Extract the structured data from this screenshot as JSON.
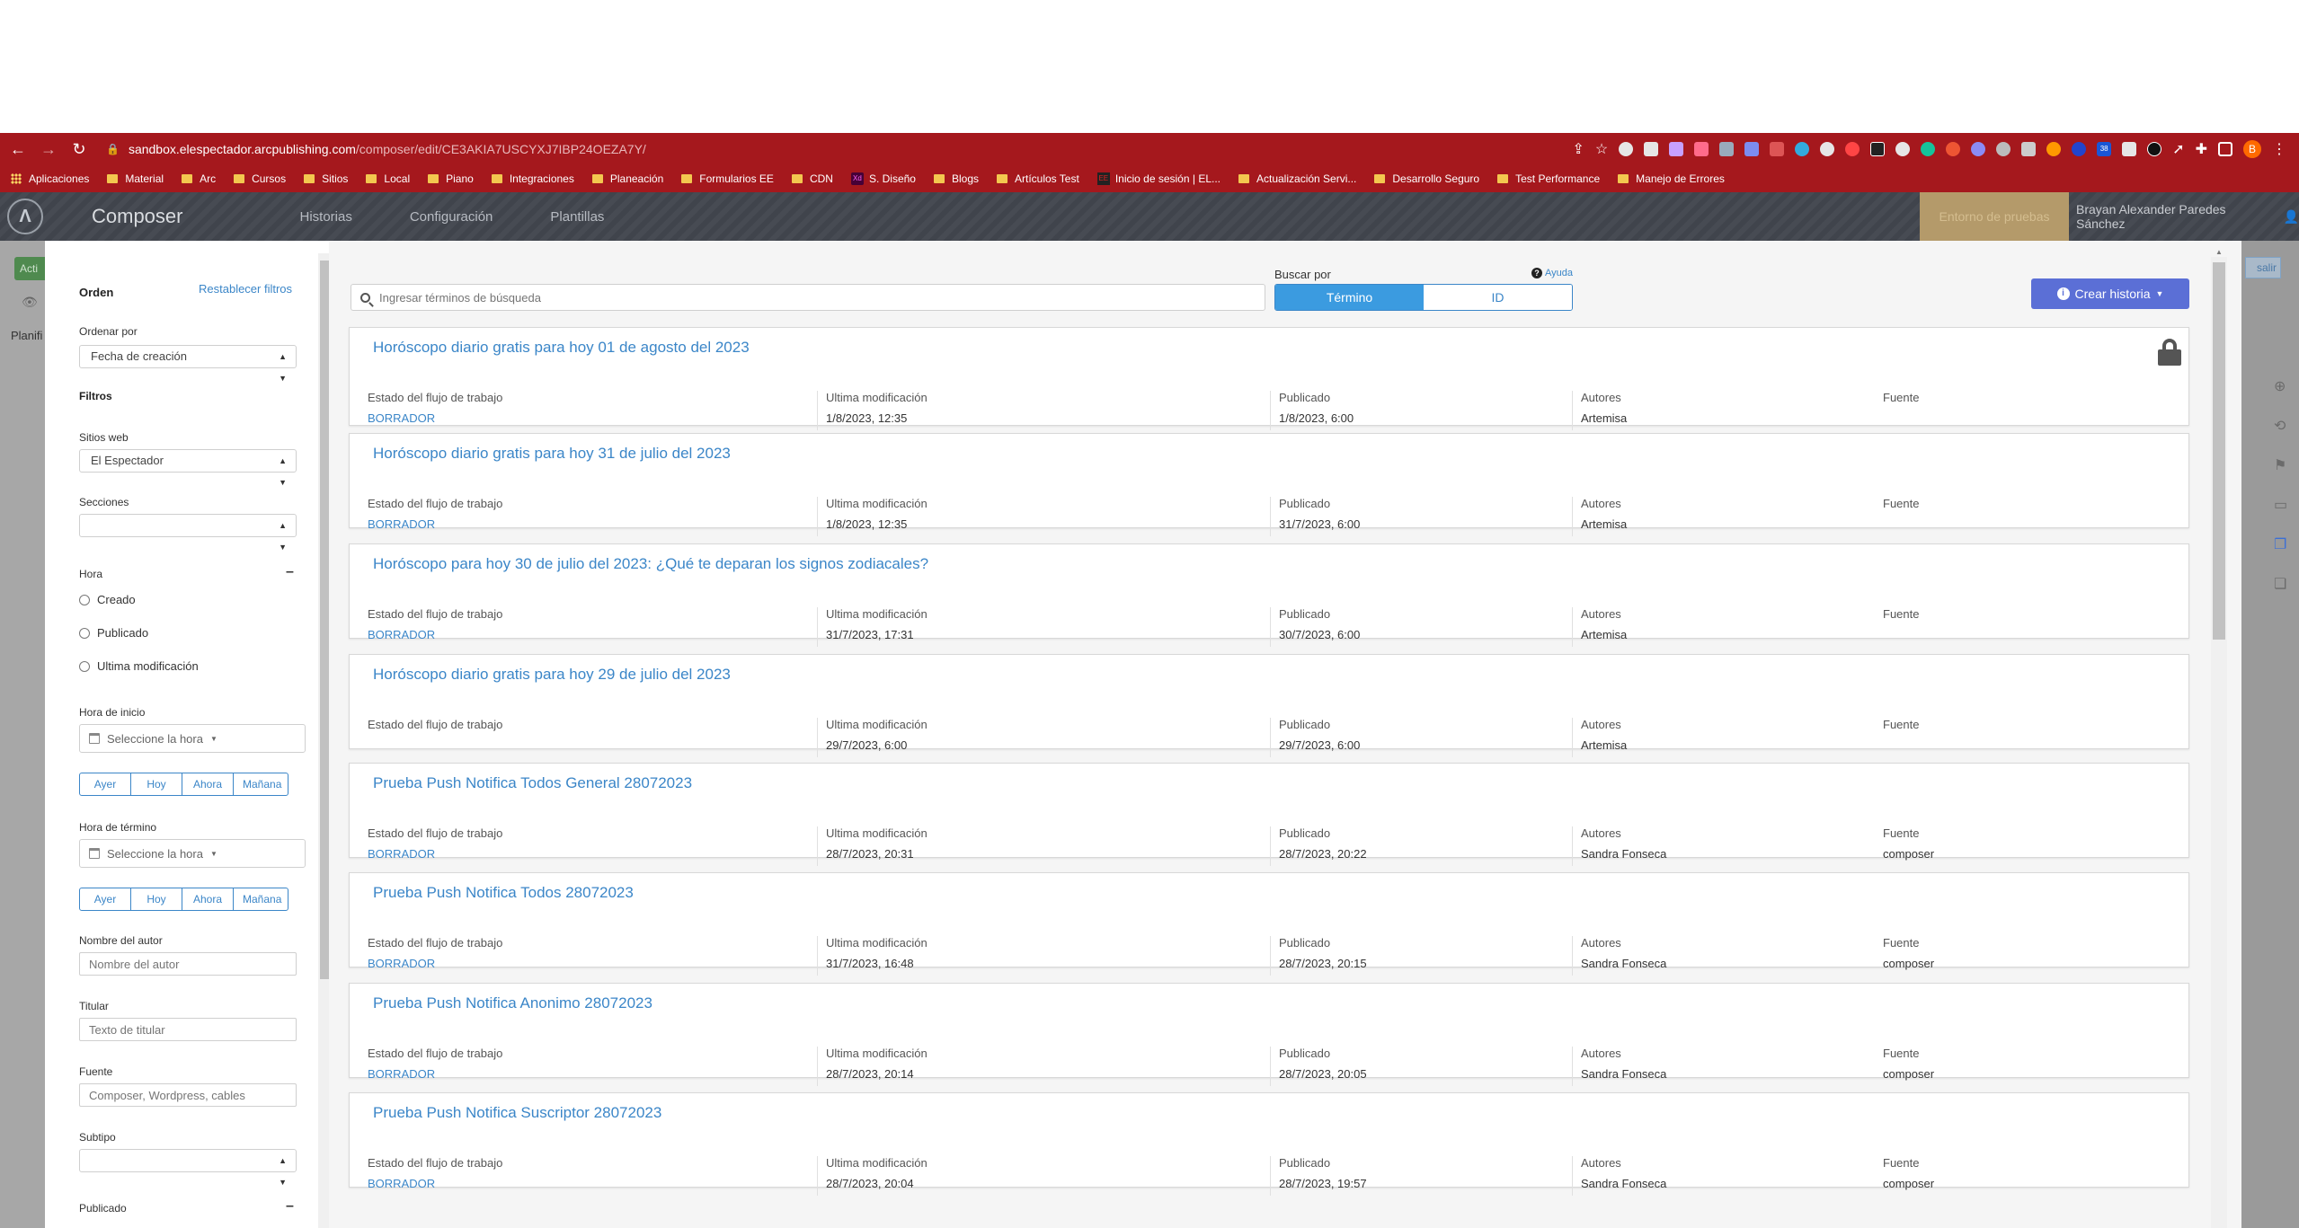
{
  "browser": {
    "url_host": "sandbox.elespectador.arcpublishing.com",
    "url_path": "/composer/edit/CE3AKIA7USCYXJ7IBP24OEZA7Y/",
    "profile_initial": "B",
    "ext_badge": "38",
    "bookmarks": [
      {
        "label": "Aplicaciones",
        "icon": "apps-grid-icon"
      },
      {
        "label": "Material",
        "icon": "folder-icon"
      },
      {
        "label": "Arc",
        "icon": "folder-icon"
      },
      {
        "label": "Cursos",
        "icon": "folder-icon"
      },
      {
        "label": "Sitios",
        "icon": "folder-icon"
      },
      {
        "label": "Local",
        "icon": "folder-icon"
      },
      {
        "label": "Piano",
        "icon": "folder-icon"
      },
      {
        "label": "Integraciones",
        "icon": "folder-icon"
      },
      {
        "label": "Planeación",
        "icon": "folder-icon"
      },
      {
        "label": "Formularios EE",
        "icon": "folder-icon"
      },
      {
        "label": "CDN",
        "icon": "folder-icon"
      },
      {
        "label": "S. Diseño",
        "icon": "xd-icon"
      },
      {
        "label": "Blogs",
        "icon": "folder-icon"
      },
      {
        "label": "Artículos Test",
        "icon": "folder-icon"
      },
      {
        "label": "Inicio de sesión | EL...",
        "icon": "ee-icon"
      },
      {
        "label": "Actualización Servi...",
        "icon": "folder-icon"
      },
      {
        "label": "Desarrollo Seguro",
        "icon": "folder-icon"
      },
      {
        "label": "Test Performance",
        "icon": "folder-icon"
      },
      {
        "label": "Manejo de Errores",
        "icon": "folder-icon"
      }
    ]
  },
  "app": {
    "title": "Composer",
    "nav": [
      "Historias",
      "Configuración",
      "Plantillas"
    ],
    "env_badge": "Entorno de pruebas",
    "user": "Brayan Alexander Paredes Sánchez"
  },
  "background": {
    "green_btn": "Acti",
    "plan_label": "Planifi",
    "right_btn": "salir"
  },
  "sidebar": {
    "orden": "Orden",
    "reset": "Restablecer filtros",
    "ordenar_por": "Ordenar por",
    "ordenar_value": "Fecha de creación",
    "filtros": "Filtros",
    "sitios_label": "Sitios web",
    "sitios_value": "El Espectador",
    "secciones_label": "Secciones",
    "secciones_value": "",
    "hora_label": "Hora",
    "radios": [
      "Creado",
      "Publicado",
      "Ultima modificación"
    ],
    "hora_inicio_label": "Hora de inicio",
    "hora_termino_label": "Hora de término",
    "time_placeholder": "Seleccione la hora",
    "quick_buttons": [
      "Ayer",
      "Hoy",
      "Ahora",
      "Mañana"
    ],
    "autor_label": "Nombre del autor",
    "autor_placeholder": "Nombre del autor",
    "titular_label": "Titular",
    "titular_placeholder": "Texto de titular",
    "fuente_label": "Fuente",
    "fuente_placeholder": "Composer, Wordpress, cables",
    "subtipo_label": "Subtipo",
    "subtipo_value": "",
    "publicado_label": "Publicado"
  },
  "main": {
    "search_placeholder": "Ingresar términos de búsqueda",
    "buscar_por": "Buscar por",
    "ayuda": "Ayuda",
    "toggle": [
      "Término",
      "ID"
    ],
    "crear": "Crear historia",
    "col_labels": [
      "Estado del flujo de trabajo",
      "Ultima modificación",
      "Publicado",
      "Autores",
      "Fuente"
    ],
    "stories": [
      {
        "title": "Horóscopo diario gratis para hoy 01 de agosto del 2023",
        "estado": "BORRADOR",
        "modificado": "1/8/2023, 12:35",
        "publicado": "1/8/2023, 6:00",
        "autores": "Artemisa",
        "fuente": "",
        "locked": true
      },
      {
        "title": "Horóscopo diario gratis para hoy 31 de julio del 2023",
        "estado": "BORRADOR",
        "modificado": "1/8/2023, 12:35",
        "publicado": "31/7/2023, 6:00",
        "autores": "Artemisa",
        "fuente": "",
        "locked": false
      },
      {
        "title": "Horóscopo para hoy 30 de julio del 2023: ¿Qué te deparan los signos zodiacales?",
        "estado": "BORRADOR",
        "modificado": "31/7/2023, 17:31",
        "publicado": "30/7/2023, 6:00",
        "autores": "Artemisa",
        "fuente": "",
        "locked": false
      },
      {
        "title": "Horóscopo diario gratis para hoy 29 de julio del 2023",
        "estado": "",
        "modificado": "29/7/2023, 6:00",
        "publicado": "29/7/2023, 6:00",
        "autores": "Artemisa",
        "fuente": "",
        "locked": false
      },
      {
        "title": "Prueba Push Notifica Todos General 28072023",
        "estado": "BORRADOR",
        "modificado": "28/7/2023, 20:31",
        "publicado": "28/7/2023, 20:22",
        "autores": "Sandra Fonseca",
        "fuente": "composer",
        "locked": false
      },
      {
        "title": "Prueba Push Notifica Todos 28072023",
        "estado": "BORRADOR",
        "modificado": "31/7/2023, 16:48",
        "publicado": "28/7/2023, 20:15",
        "autores": "Sandra Fonseca",
        "fuente": "composer",
        "locked": false
      },
      {
        "title": "Prueba Push Notifica Anonimo 28072023",
        "estado": "BORRADOR",
        "modificado": "28/7/2023, 20:14",
        "publicado": "28/7/2023, 20:05",
        "autores": "Sandra Fonseca",
        "fuente": "composer",
        "locked": false
      },
      {
        "title": "Prueba Push Notifica Suscriptor 28072023",
        "estado": "BORRADOR",
        "modificado": "28/7/2023, 20:04",
        "publicado": "28/7/2023, 19:57",
        "autores": "Sandra Fonseca",
        "fuente": "composer",
        "locked": false
      }
    ]
  },
  "colors": {
    "chrome": "#a5181d",
    "link": "#3b86c8",
    "primary_btn": "#5b6fd6"
  }
}
